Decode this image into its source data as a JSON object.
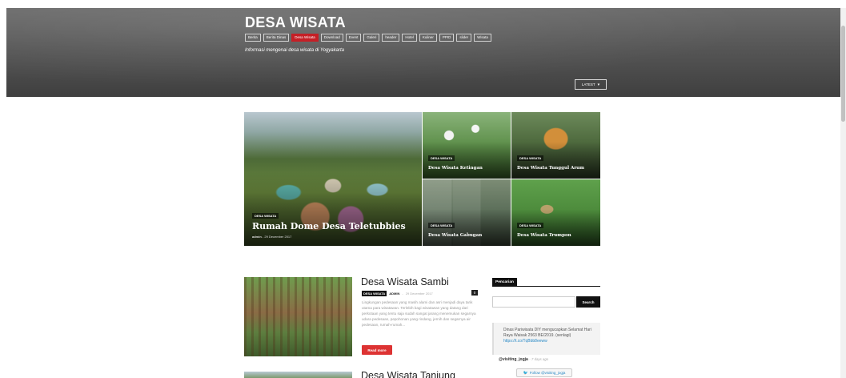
{
  "site": {
    "title": "DESA WISATA",
    "tagline": "Informasi mengenai desa wisata di Yogyakarta",
    "latest_label": "LATEST"
  },
  "nav": {
    "items": [
      "Berita",
      "Berita Dinas",
      "Desa Wisata",
      "Download",
      "Event",
      "Galeri",
      "header",
      "Hotel",
      "Kuliner",
      "PPID",
      "slider",
      "Wisata"
    ],
    "active": "Desa Wisata"
  },
  "featured": {
    "main": {
      "category": "DESA WISATA",
      "title": "Rumah Dome Desa Teletubbies",
      "author": "admin",
      "date": "29 December 2017"
    },
    "tiles": [
      {
        "category": "DESA WISATA",
        "title": "Desa Wisata Ketingan"
      },
      {
        "category": "DESA WISATA",
        "title": "Desa Wisata Tunggul Arum"
      },
      {
        "category": "DESA WISATA",
        "title": "Desa Wisata Gabugan"
      },
      {
        "category": "DESA WISATA",
        "title": "Desa Wisata Trumpon"
      }
    ]
  },
  "post": {
    "title": "Desa Wisata Sambi",
    "category": "DESA WISATA",
    "author": "ADMIN",
    "date": "29 December 2017",
    "comments": "0",
    "excerpt": "Lingkungan pedesaan yang masih alami dan asri menjadi daya tarik utama para wisatawan. Terlebih bagi wisatawan yang datang dari perkotaan yang tentu saja sudah sangat jarang menemukan segarnya udara pedesaan, pepohonan yang rindang, jernih dan segarnya air pedesaan, rumah-rumah...",
    "read_more": "Read more"
  },
  "post2": {
    "title": "Desa Wisata Tanjung"
  },
  "sidebar": {
    "search_title": "Pencarian",
    "search_placeholder": "",
    "search_button": "Search",
    "tweet": {
      "text": "Dinas Pariwisata DIY mengucapkan Selamat Hari Raya Waisak 2563 BE/2019. (senlagi)",
      "link": "https://t.co/TqBbb8eeww",
      "handle": "@visiting_jogja",
      "ago": "7 days ago",
      "follow_label": "Follow @visiting_jogja"
    }
  },
  "colors": {
    "accent": "#c51f26",
    "header_bg": "#555555",
    "dark": "#111111"
  }
}
